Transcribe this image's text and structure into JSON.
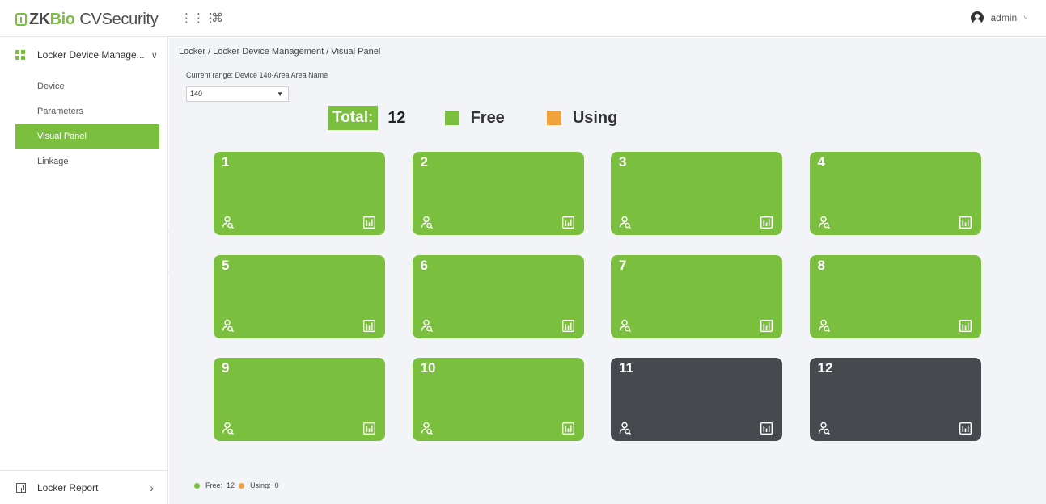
{
  "app": {
    "logo_zk": "ZK",
    "logo_bio": "Bio",
    "logo_cv": "CVSecurity",
    "user": "admin"
  },
  "topbar_icons": [
    "apps-grid-icon",
    "command-icon"
  ],
  "sidebar": {
    "module_label": "Locker Device Manage...",
    "items": [
      {
        "label": "Device",
        "active": false
      },
      {
        "label": "Parameters",
        "active": false
      },
      {
        "label": "Visual Panel",
        "active": true
      },
      {
        "label": "Linkage",
        "active": false
      }
    ],
    "report_label": "Locker Report"
  },
  "main": {
    "breadcrumb": "Locker / Locker Device Management / Visual Panel",
    "range_label": "Current range: Device 140-Area Area Name",
    "select_value": "140",
    "total_label": "Total:",
    "total_count": "12",
    "legend": [
      {
        "label": "Free",
        "color": "#7bbf3f"
      },
      {
        "label": "Using",
        "color": "#f2a23c"
      }
    ],
    "footer": {
      "free_label": "Free:",
      "free_count": "12",
      "using_label": "Using:",
      "using_count": "0"
    }
  },
  "colors": {
    "free": "#7bbf3f",
    "using": "#f2a23c",
    "disabled": "#46494d"
  },
  "lockers": [
    {
      "number": "1",
      "state": "free"
    },
    {
      "number": "2",
      "state": "free"
    },
    {
      "number": "3",
      "state": "free"
    },
    {
      "number": "4",
      "state": "free"
    },
    {
      "number": "5",
      "state": "free"
    },
    {
      "number": "6",
      "state": "free"
    },
    {
      "number": "7",
      "state": "free"
    },
    {
      "number": "8",
      "state": "free"
    },
    {
      "number": "9",
      "state": "free"
    },
    {
      "number": "10",
      "state": "free"
    },
    {
      "number": "11",
      "state": "disabled"
    },
    {
      "number": "12",
      "state": "disabled"
    }
  ]
}
